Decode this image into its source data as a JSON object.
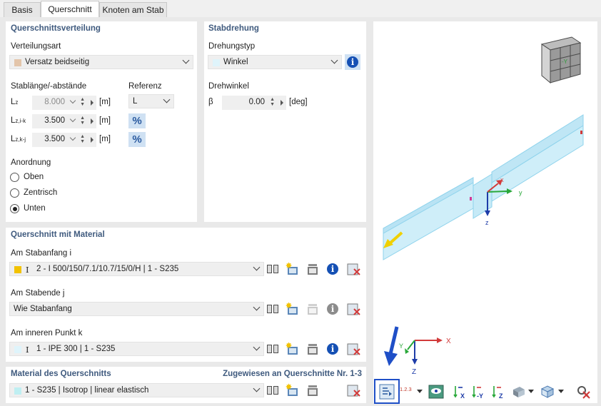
{
  "tabs": [
    {
      "label": "Basis"
    },
    {
      "label": "Querschnitt"
    },
    {
      "label": "Knoten am Stab"
    }
  ],
  "distribution": {
    "title": "Querschnittsverteilung",
    "type_label": "Verteilungsart",
    "type_value": "Versatz beidseitig",
    "type_color": "#e3c5aa",
    "lengths_label": "Stablänge/-abstände",
    "reference_label": "Referenz",
    "reference_value": "L",
    "rows": [
      {
        "symbol": "L",
        "sub": "z",
        "value": "8.000",
        "unit": "[m]"
      },
      {
        "symbol": "L",
        "sub": "z,i-k",
        "value": "3.500",
        "unit": "[m]"
      },
      {
        "symbol": "L",
        "sub": "z,k-j",
        "value": "3.500",
        "unit": "[m]"
      }
    ],
    "percent_symbol": "%",
    "arrangement_label": "Anordnung",
    "options": [
      "Oben",
      "Zentrisch",
      "Unten"
    ],
    "selected_option": "Unten"
  },
  "rotation": {
    "title": "Stabdrehung",
    "type_label": "Drehungstyp",
    "type_value": "Winkel",
    "type_color": "#dff4fb",
    "angle_label": "Drehwinkel",
    "angle_symbol": "β",
    "angle_value": "0.00",
    "angle_unit": "[deg]",
    "info_symbol": "i"
  },
  "section_material": {
    "title": "Querschnitt mit Material",
    "start_label": "Am Stabanfang i",
    "start_value": "2 - I 500/150/7.1/10.7/15/0/H | 1 - S235",
    "start_color": "#f2c200",
    "end_label": "Am Stabende j",
    "end_value": "Wie Stabanfang",
    "inner_label": "Am inneren Punkt k",
    "inner_value": "1 - IPE 300 | 1 - S235",
    "inner_color": "#dff4fb",
    "section_symbol": "I"
  },
  "material": {
    "title": "Material des Querschnitts",
    "assigned": "Zugewiesen an Querschnitte Nr. 1-3",
    "value": "1 - S235 | Isotrop | linear elastisch",
    "color": "#bfeff2"
  },
  "viewport": {
    "axis_x": "x",
    "axis_y": "y",
    "axis_z": "z",
    "triad_x": "X",
    "triad_y": "Y",
    "triad_z": "Z",
    "cube_label": "-Y",
    "toolbar": {
      "numbering_label": "1.2.3",
      "view_x": "X",
      "view_y": "-Y",
      "view_z": "Z"
    },
    "highlight_color": "#1f4fc7"
  }
}
